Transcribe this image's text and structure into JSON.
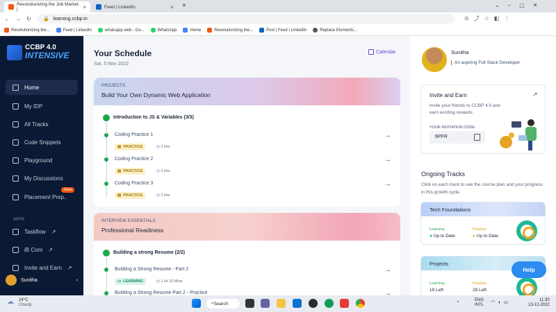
{
  "browser": {
    "tabs": [
      {
        "title": "Revolutionizing the Job Market |",
        "active": true,
        "favicon_color": "#f2570f"
      },
      {
        "title": "Feed | LinkedIn",
        "active": false,
        "favicon_color": "#0a66c2"
      }
    ],
    "new_tab": "+",
    "url": "learning.ccbp.in",
    "bookmarks": [
      "Revolutionizing the...",
      "Feed | LinkedIn",
      "whatsapp web - Go...",
      "WhatsApp",
      "Home",
      "Revolutionizing the...",
      "Post | Feed | LinkedIn",
      "Replace Elements..."
    ]
  },
  "sidebar": {
    "logo_line1": "CCBP 4.0",
    "logo_line2": "INTENSIVE",
    "items": [
      {
        "label": "Home",
        "active": true
      },
      {
        "label": "My IDP"
      },
      {
        "label": "All Tracks"
      },
      {
        "label": "Code Snippets"
      },
      {
        "label": "Playground"
      },
      {
        "label": "My Discussions"
      },
      {
        "label": "Placement Prep..",
        "badge": "New"
      }
    ],
    "apps_label": "APPS",
    "apps": [
      {
        "label": "Taskflow"
      },
      {
        "label": "iB Com"
      },
      {
        "label": "Invite and Earn"
      }
    ],
    "user": "Sunitha"
  },
  "schedule": {
    "title": "Your Schedule",
    "date": "Sat, 5 Nov 2022",
    "calendar_label": "Calendar",
    "cards": [
      {
        "tag": "PROJECTS",
        "name": "Build Your Own Dynamic Web Application",
        "section": "Introduction to JS & Variables (3/3)",
        "items": [
          {
            "title": "Coding Practice 1",
            "type": "PRACTICE",
            "duration": "2 Hrs"
          },
          {
            "title": "Coding Practice 2",
            "type": "PRACTICE",
            "duration": "2 Hrs"
          },
          {
            "title": "Coding Practice 3",
            "type": "PRACTICE",
            "duration": "2 Hrs"
          }
        ]
      },
      {
        "tag": "INTERVIEW ESSENTIALS",
        "name": "Professional Readiness",
        "section": "Building a strong Resume (2/2)",
        "items": [
          {
            "title": "Building a Strong Resume - Part 2",
            "type": "LEARNING",
            "duration": "1 Hr 10 Mins"
          },
          {
            "title": "Building a Strong Resume Part 2 - Practice"
          }
        ]
      }
    ]
  },
  "profile": {
    "name": "Sunitha",
    "role": "An aspiring Full Stack Developer"
  },
  "invite": {
    "title": "Invite and Earn",
    "desc": "Invite your friends to CCBP 4.0 and earn exciting rewards",
    "code_label": "YOUR INVITATION CODE:",
    "code": "6PFR"
  },
  "ongoing": {
    "title": "Ongoing Tracks",
    "desc": "Click on each track to see the course plan and your progress in this growth cycle.",
    "tracks": [
      {
        "name": "Tech Foundations",
        "l1": "Learning",
        "v1": "Up to Date",
        "l2": "Practice",
        "v2": "Up to Date"
      },
      {
        "name": "Projects",
        "l1": "Learning",
        "v1": "19 Left",
        "l2": "Practice",
        "v2": "28 Left"
      }
    ]
  },
  "help_label": "Help",
  "taskbar": {
    "weather_temp": "24°C",
    "weather_desc": "Cloudy",
    "search": "Search",
    "lang1": "ENG",
    "lang2": "INTL",
    "time": "11:30",
    "date": "13-12-2022"
  }
}
